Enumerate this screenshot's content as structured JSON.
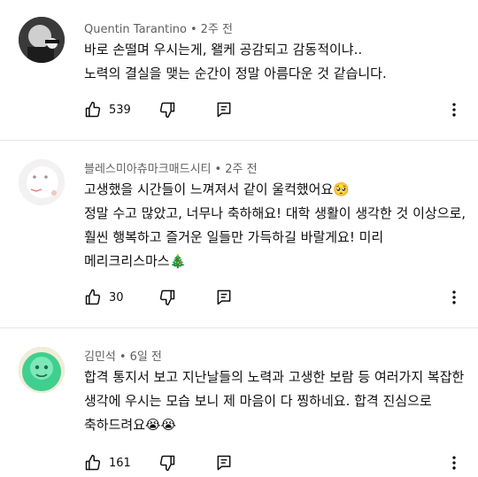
{
  "comments": [
    {
      "author": "Quentin Tarantino",
      "time": "2주 전",
      "lines": [
        "바로 손떨며 우시는게, 왤케 공감되고 감동적이냐..",
        "노력의 결실을 맺는 순간이 정말 아름다운 것 같습니다."
      ],
      "likes": "539",
      "avatar_color": "#2b2b2b"
    },
    {
      "author": "블레스미아츄마크매드시티",
      "time": "2주 전",
      "lines": [
        "고생했을 시간들이 느껴져서 같이 울컥했어요🥺",
        "정말 수고 많았고, 너무나 축하해요! 대학 생활이 생각한 것 이상으로,",
        "훨씬 행복하고 즐거운 일들만 가득하길 바랄게요! 미리",
        "메리크리스마스🎄"
      ],
      "likes": "30",
      "avatar_color": "#efefef"
    },
    {
      "author": "김민석",
      "time": "6일 전",
      "lines": [
        "합격 통지서 보고 지난날들의 노력과 고생한 보람 등 여러가지 복잡한",
        "생각에 우시는 모습 보니 제 마음이 다 찡하네요. 합격 진심으로",
        "축하드려요😭😭"
      ],
      "likes": "161",
      "avatar_color": "#4fd7a3"
    }
  ],
  "icons": {
    "like": "thumb-up-icon",
    "dislike": "thumb-down-icon",
    "reply": "reply-icon",
    "more": "more-vert-icon"
  }
}
